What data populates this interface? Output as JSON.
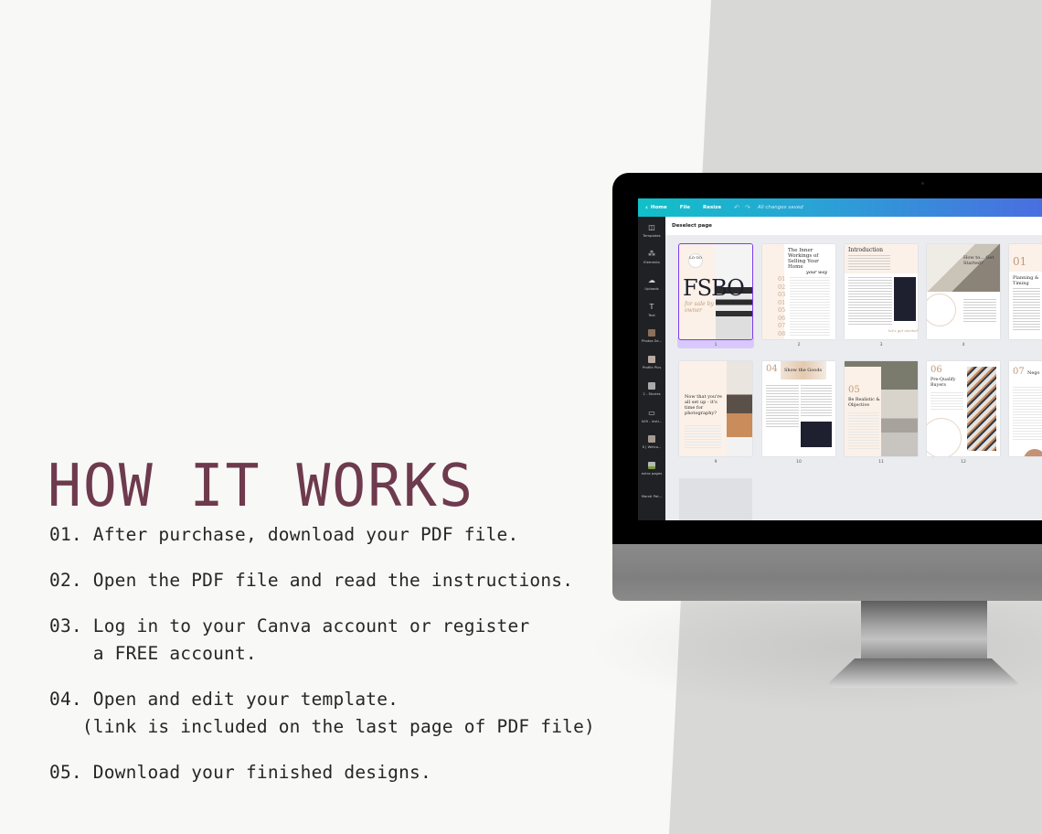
{
  "heading": "HOW IT WORKS",
  "steps": [
    {
      "num": "01.",
      "text": "After purchase, download your PDF file.",
      "line2": ""
    },
    {
      "num": "02.",
      "text": "Open the PDF file and read the instructions.",
      "line2": ""
    },
    {
      "num": "03.",
      "text": "Log in to your Canva account or register",
      "line2": "    a FREE account."
    },
    {
      "num": "04.",
      "text": "Open and edit your template.",
      "line2": "   (link is included on the last page of PDF file)"
    },
    {
      "num": "05.",
      "text": "Download your finished designs.",
      "line2": ""
    }
  ],
  "colors": {
    "heading": "#6e3a4e",
    "topbar_start": "#10c0c8",
    "topbar_end": "#4a6ee0",
    "selection": "#7d3cf0"
  },
  "editor": {
    "topbar": {
      "back_icon": "chevron-left-icon",
      "home": "Home",
      "file": "File",
      "resize": "Resize",
      "undo_icon": "undo-icon",
      "redo_icon": "redo-icon",
      "status": "All changes saved"
    },
    "subbar": {
      "deselect": "Deselect page"
    },
    "sidebar": [
      {
        "label": "Templates",
        "icon": "templates-icon",
        "glyph": "◫"
      },
      {
        "label": "Elements",
        "icon": "elements-icon",
        "glyph": "⁂"
      },
      {
        "label": "Uploads",
        "icon": "upload-cloud-icon",
        "glyph": "☁"
      },
      {
        "label": "Text",
        "icon": "text-icon",
        "glyph": "T"
      },
      {
        "label": "Photos Se...",
        "icon": "folder-thumb-icon",
        "glyph": ""
      },
      {
        "label": "Profile Pics",
        "icon": "folder-thumb-icon",
        "glyph": ""
      },
      {
        "label": "2 - Stories",
        "icon": "folder-thumb-icon",
        "glyph": ""
      },
      {
        "label": "A09 - Insti...",
        "icon": "folder-icon",
        "glyph": "▭"
      },
      {
        "label": "8 | Welco...",
        "icon": "folder-thumb-icon",
        "glyph": ""
      },
      {
        "label": "extra pages",
        "icon": "folder-thumb-icon",
        "glyph": ""
      },
      {
        "label": "Marsti Pat...",
        "icon": "folder-icon",
        "glyph": ""
      }
    ],
    "pages": [
      {
        "num": "1",
        "title": "FSBO",
        "subtitle": "for sale by owner",
        "logo": "LO GO",
        "selected": true
      },
      {
        "num": "2",
        "title": "The Inner Workings of Selling Your Home",
        "script": "your way",
        "toc": [
          "01",
          "02",
          "03",
          "01",
          "05",
          "06",
          "07",
          "08"
        ]
      },
      {
        "num": "3",
        "title": "Introduction",
        "script": "let's get started"
      },
      {
        "num": "4",
        "title": "How to... Get Started?"
      },
      {
        "num": "",
        "title": "Planning & Timing",
        "chapter": "01"
      },
      {
        "num": "9",
        "title": "Now that you're all set up - it's time for photography?"
      },
      {
        "num": "10",
        "title": "Show the Goods",
        "chapter": "04"
      },
      {
        "num": "11",
        "title": "Be Realistic & Objective",
        "chapter": "05"
      },
      {
        "num": "12",
        "title": "Pre-Qualify Buyers",
        "chapter": "06"
      },
      {
        "num": "",
        "title": "Nego",
        "chapter": "07"
      }
    ]
  }
}
